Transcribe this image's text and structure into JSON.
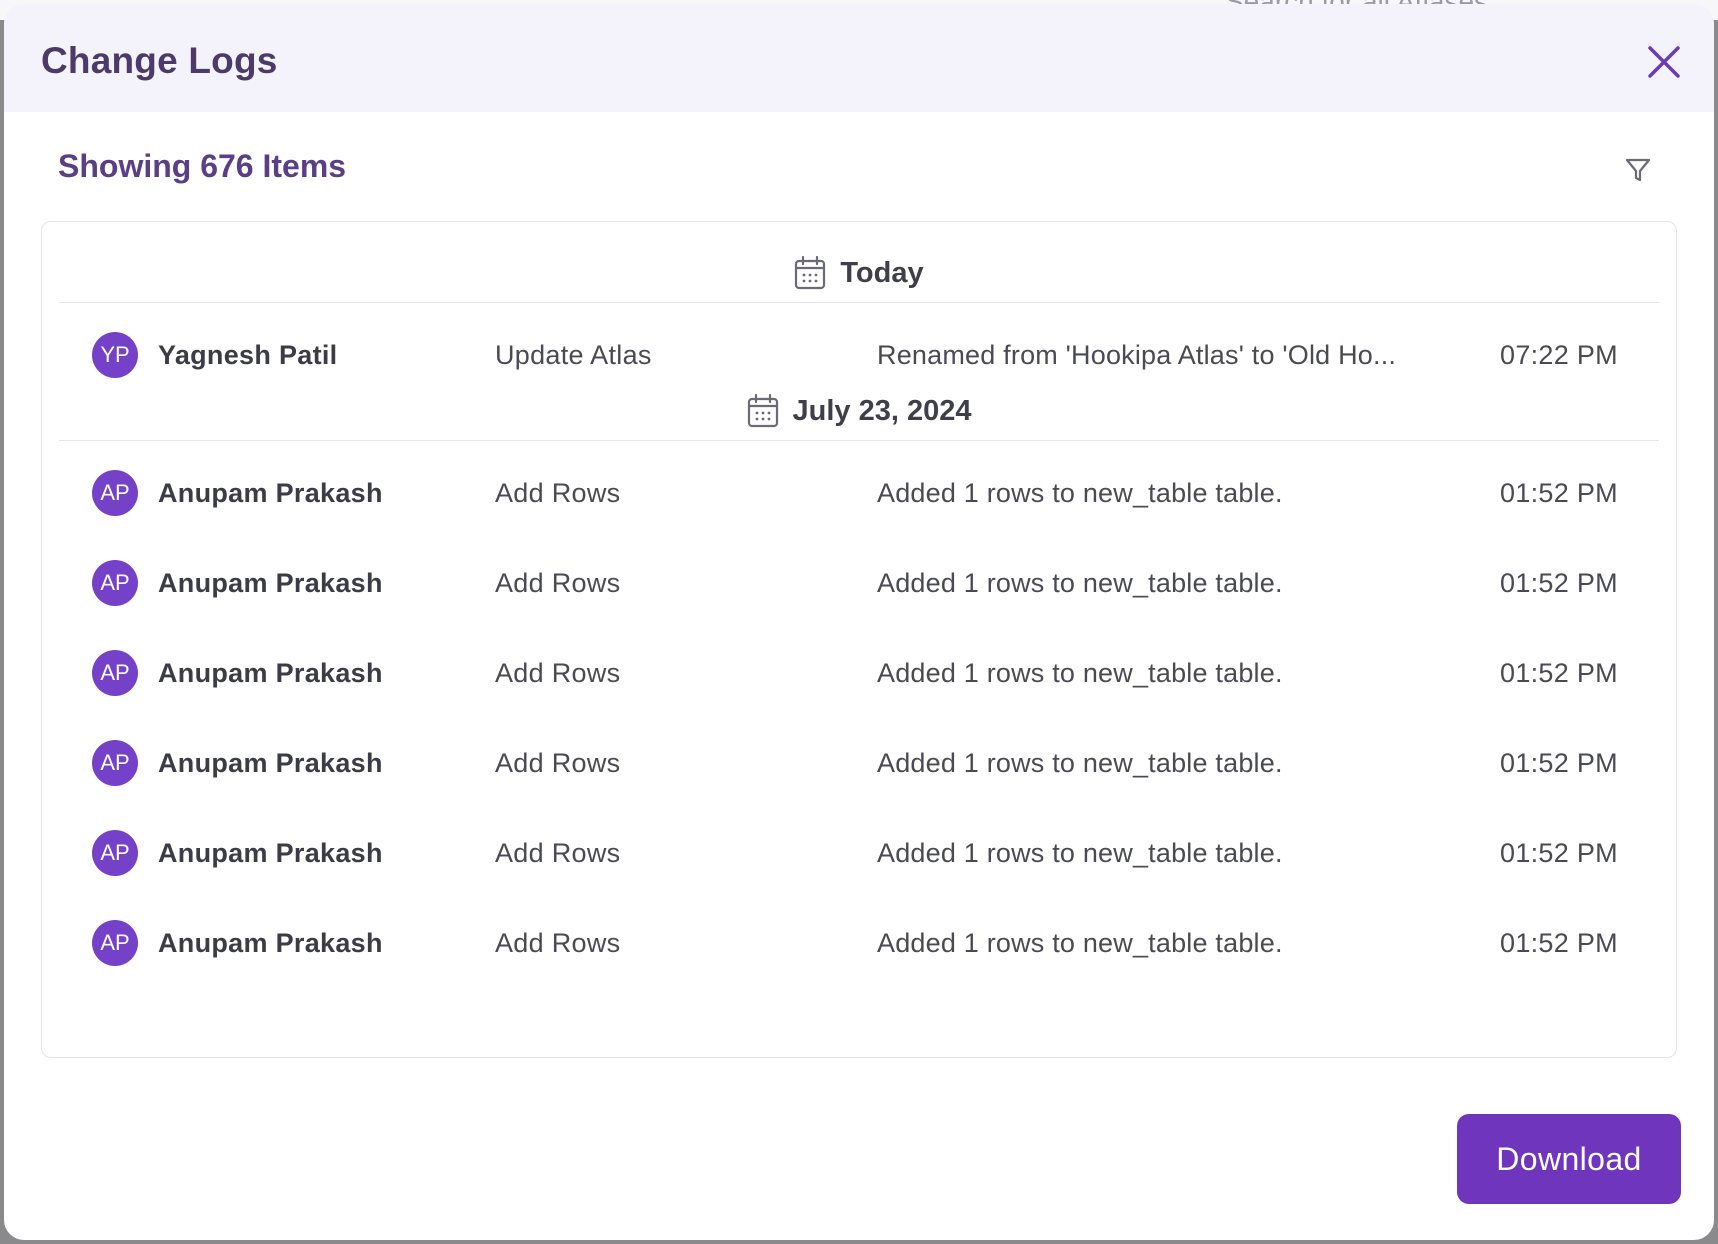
{
  "background": {
    "partial_text": "Search for all Atlases"
  },
  "modal": {
    "title": "Change Logs",
    "item_count_label": "Showing 676 Items",
    "download_label": "Download",
    "accent_color": "#6f35bd"
  },
  "groups": [
    {
      "label": "Today",
      "entries": [
        {
          "initials": "YP",
          "user": "Yagnesh Patil",
          "action": "Update Atlas",
          "details": "Renamed from 'Hookipa Atlas' to 'Old Ho...",
          "time": "07:22 PM"
        }
      ]
    },
    {
      "label": "July 23, 2024",
      "entries": [
        {
          "initials": "AP",
          "user": "Anupam Prakash",
          "action": "Add Rows",
          "details": "Added 1 rows to new_table table.",
          "time": "01:52 PM"
        },
        {
          "initials": "AP",
          "user": "Anupam Prakash",
          "action": "Add Rows",
          "details": "Added 1 rows to new_table table.",
          "time": "01:52 PM"
        },
        {
          "initials": "AP",
          "user": "Anupam Prakash",
          "action": "Add Rows",
          "details": "Added 1 rows to new_table table.",
          "time": "01:52 PM"
        },
        {
          "initials": "AP",
          "user": "Anupam Prakash",
          "action": "Add Rows",
          "details": "Added 1 rows to new_table table.",
          "time": "01:52 PM"
        },
        {
          "initials": "AP",
          "user": "Anupam Prakash",
          "action": "Add Rows",
          "details": "Added 1 rows to new_table table.",
          "time": "01:52 PM"
        },
        {
          "initials": "AP",
          "user": "Anupam Prakash",
          "action": "Add Rows",
          "details": "Added 1 rows to new_table table.",
          "time": "01:52 PM"
        }
      ]
    }
  ]
}
